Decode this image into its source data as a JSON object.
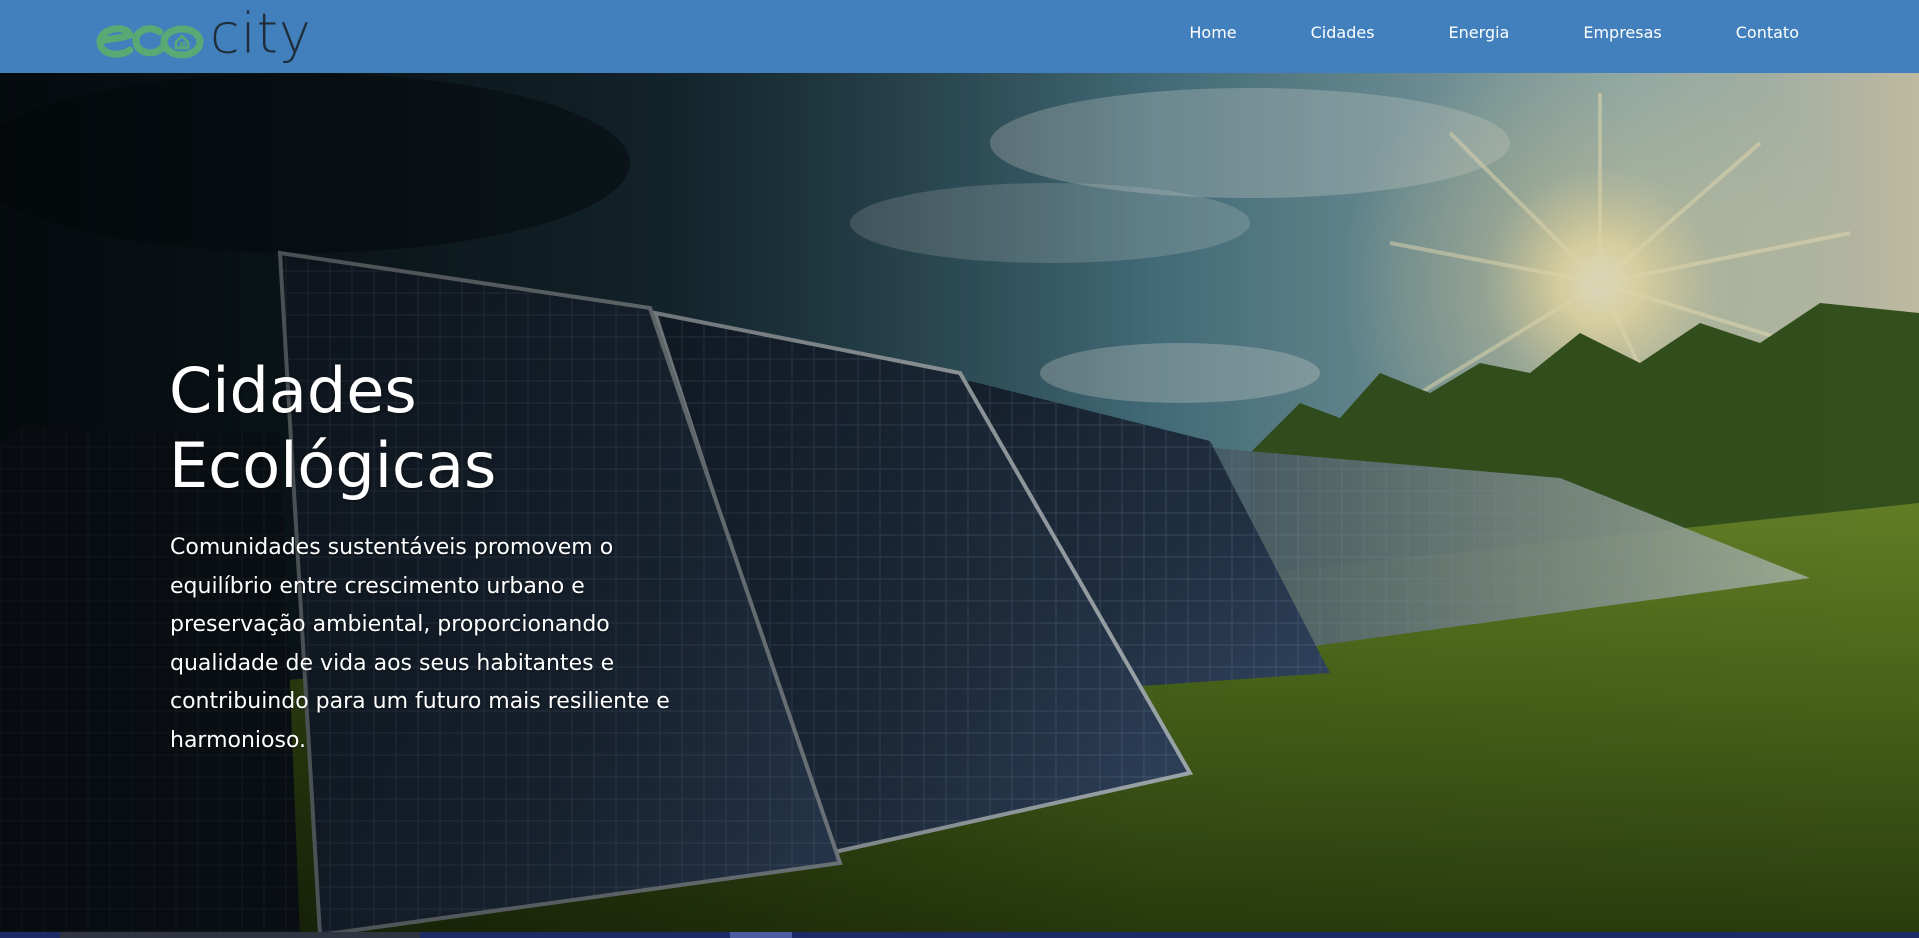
{
  "header": {
    "logo": {
      "eco_text": "eco",
      "city_text": "city",
      "eco_color": "#5aa874",
      "city_color": "#1f2d3a"
    },
    "background_color": "#4180bd",
    "nav": [
      {
        "label": "Home"
      },
      {
        "label": "Cidades"
      },
      {
        "label": "Energia"
      },
      {
        "label": "Empresas"
      },
      {
        "label": "Contato"
      }
    ]
  },
  "hero": {
    "title_line1": "Cidades",
    "title_line2": "Ecológicas",
    "text": "Comunidades sustentáveis promovem o equilíbrio entre crescimento urbano e preservação ambiental, proporcionando qualidade de vida aos seus habitantes e contribuindo para um futuro mais resiliente e harmonioso.",
    "background": "solar-panels-field-sunset-photo"
  }
}
